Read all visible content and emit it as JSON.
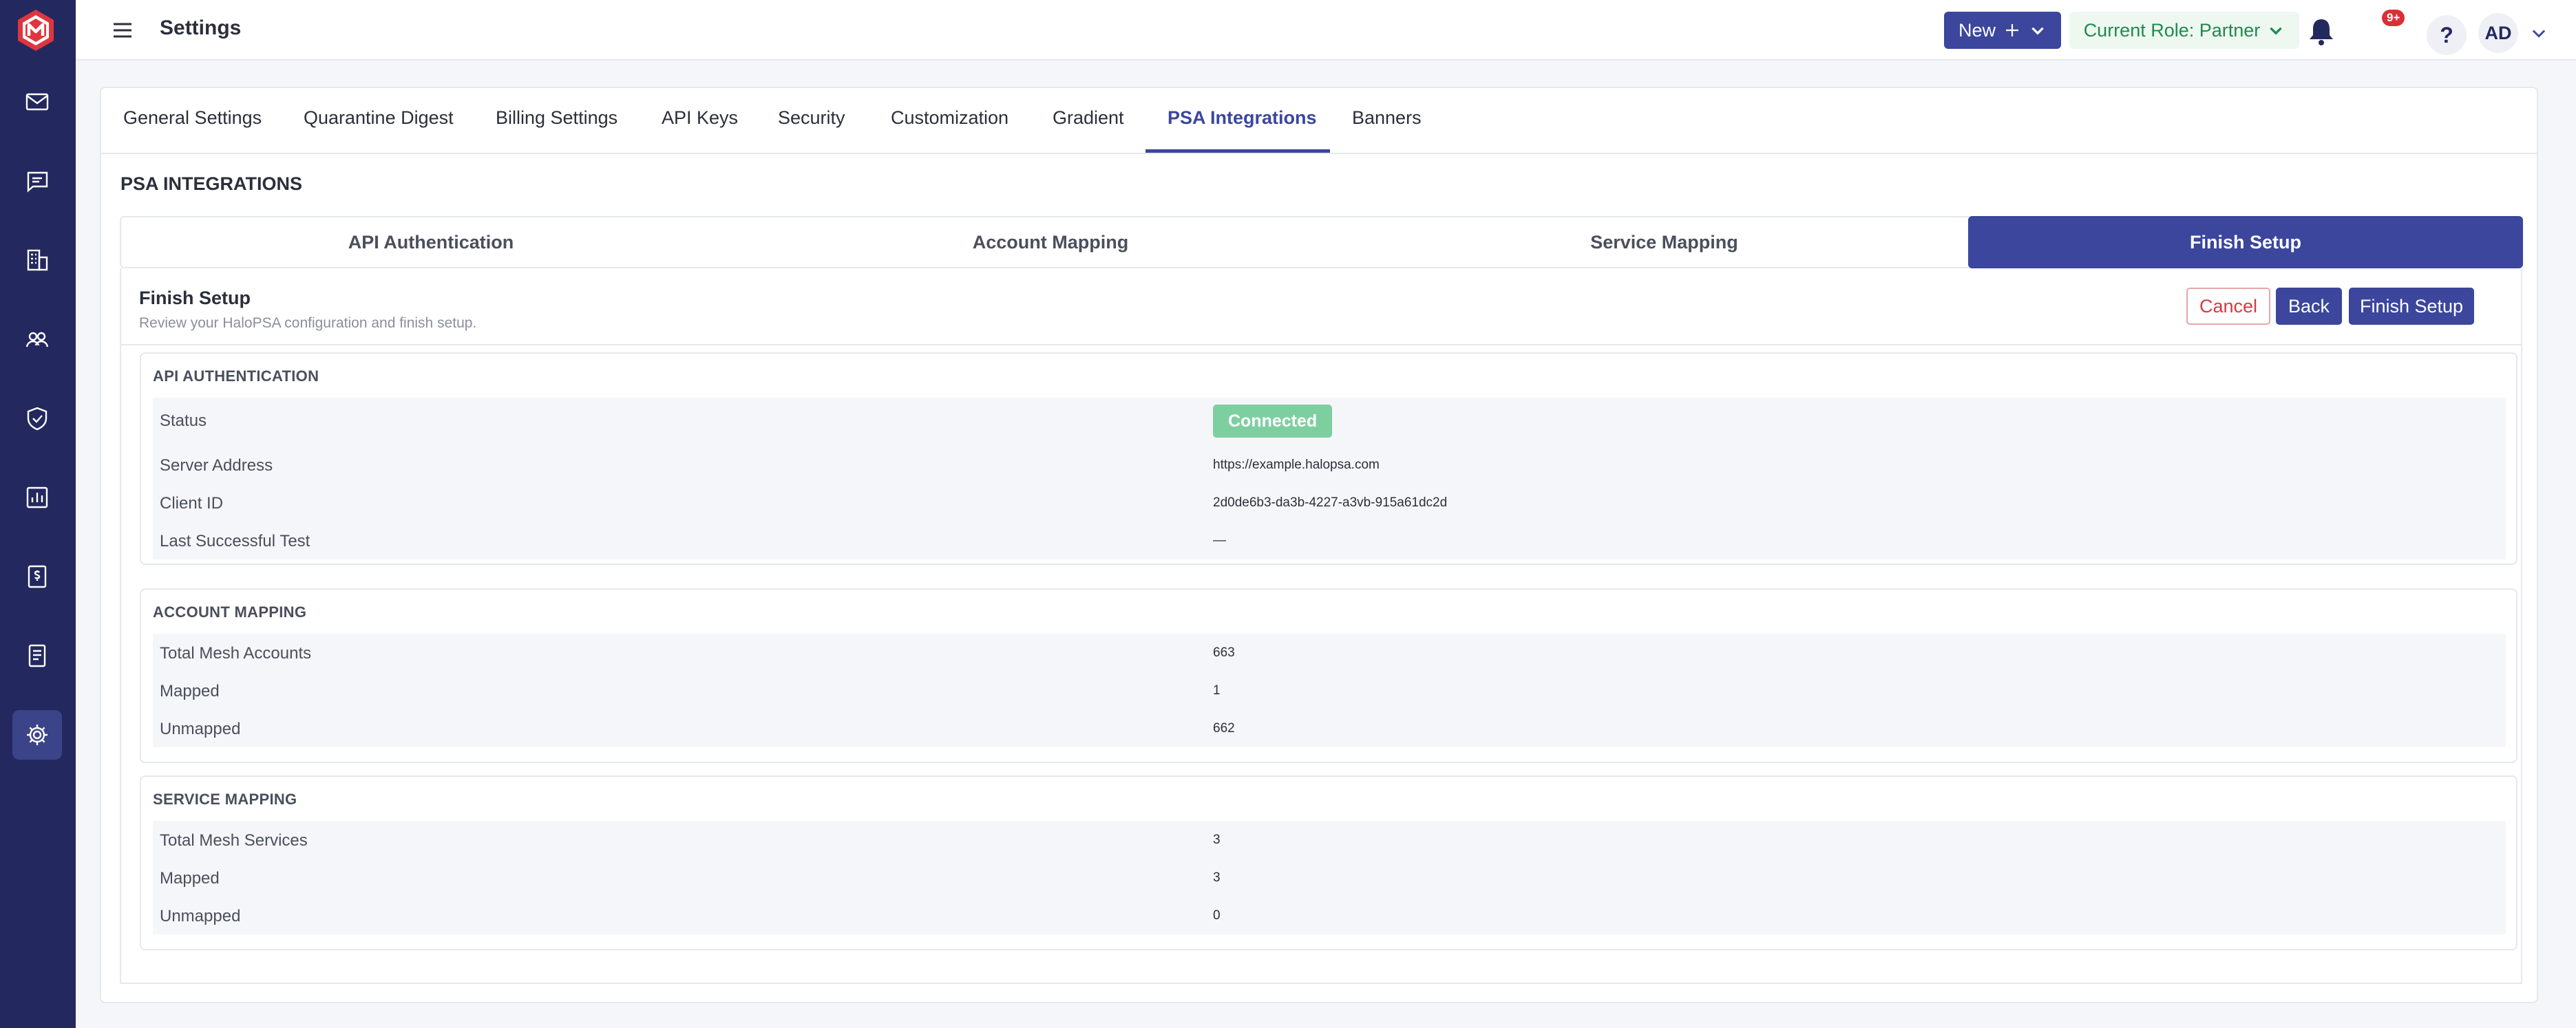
{
  "app": {
    "title": "Settings"
  },
  "header": {
    "new_label": "New",
    "role_label": "Current Role: Partner",
    "notification_badge": "9+",
    "help_label": "?",
    "user_initials": "AD"
  },
  "sidebar": {
    "items": [
      {
        "icon": "mail-icon"
      },
      {
        "icon": "message-icon"
      },
      {
        "icon": "building-icon"
      },
      {
        "icon": "users-icon"
      },
      {
        "icon": "shield-icon"
      },
      {
        "icon": "report-icon"
      },
      {
        "icon": "billing-icon"
      },
      {
        "icon": "document-icon"
      },
      {
        "icon": "gear-icon",
        "active": true
      }
    ]
  },
  "tabs": [
    "General Settings",
    "Quarantine Digest",
    "Billing Settings",
    "API Keys",
    "Security",
    "Customization",
    "Gradient",
    "PSA Integrations",
    "Banners"
  ],
  "active_tab": "PSA Integrations",
  "section_title": "PSA INTEGRATIONS",
  "steps": [
    "API Authentication",
    "Account Mapping",
    "Service Mapping",
    "Finish Setup"
  ],
  "active_step": "Finish Setup",
  "panel": {
    "title": "Finish Setup",
    "subtitle": "Review your HaloPSA configuration and finish setup.",
    "cancel_label": "Cancel",
    "back_label": "Back",
    "finish_label": "Finish Setup"
  },
  "api_auth": {
    "title": "API AUTHENTICATION",
    "status_label": "Status",
    "status_value": "Connected",
    "server_label": "Server Address",
    "server_value": "https://example.halopsa.com",
    "client_label": "Client ID",
    "client_value": "2d0de6b3-da3b-4227-a3vb-915a61dc2d",
    "last_test_label": "Last Successful Test",
    "last_test_value": "—"
  },
  "account_mapping": {
    "title": "ACCOUNT MAPPING",
    "rows": [
      {
        "label": "Total Mesh Accounts",
        "value": "663"
      },
      {
        "label": "Mapped",
        "value": "1"
      },
      {
        "label": "Unmapped",
        "value": "662"
      }
    ]
  },
  "service_mapping": {
    "title": "SERVICE MAPPING",
    "rows": [
      {
        "label": "Total Mesh Services",
        "value": "3"
      },
      {
        "label": "Mapped",
        "value": "3"
      },
      {
        "label": "Unmapped",
        "value": "0"
      }
    ]
  },
  "colors": {
    "sidebar": "#23295e",
    "primary": "#3b469c",
    "role_green": "#1f8a4f",
    "connected": "#7ecfa0",
    "cancel_red": "#d23b3f",
    "badge_red": "#d93035"
  }
}
